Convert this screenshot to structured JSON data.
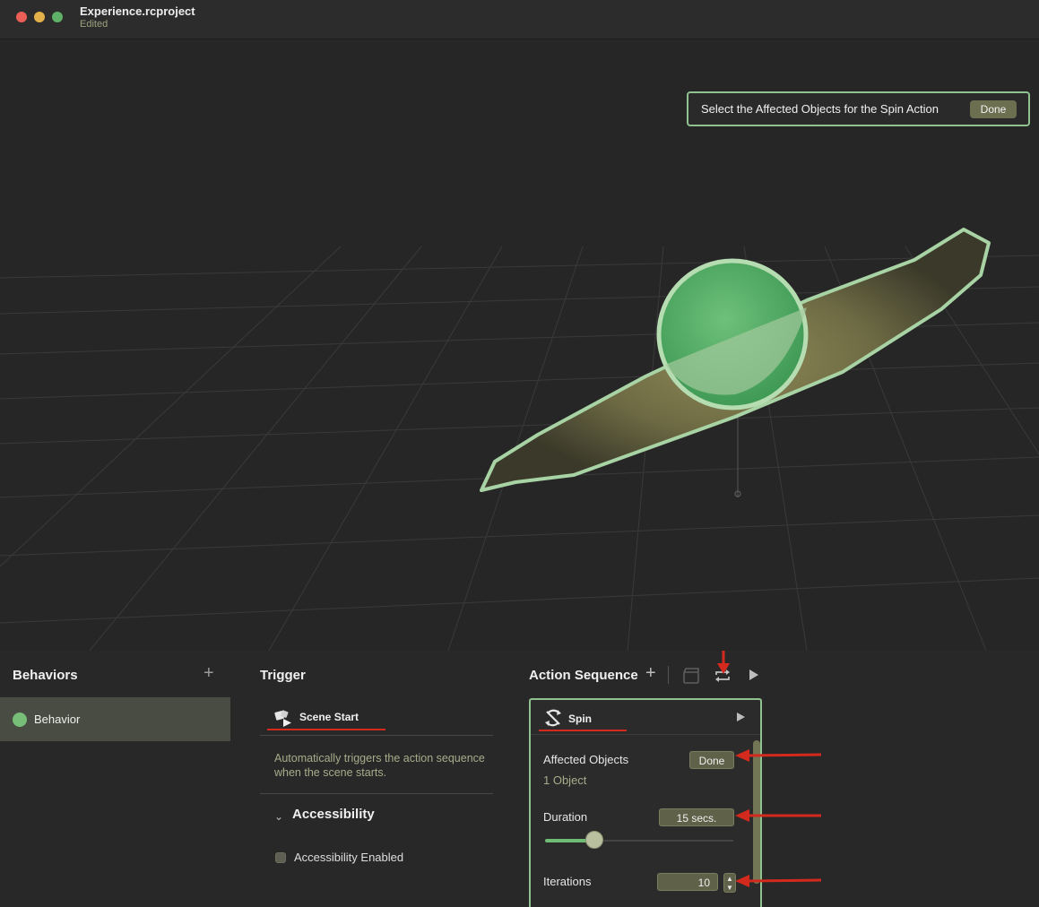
{
  "window": {
    "title": "Experience.rcproject",
    "subtitle": "Edited"
  },
  "banner": {
    "message": "Select the Affected Objects for the Spin Action",
    "done_label": "Done"
  },
  "behaviors": {
    "header": "Behaviors",
    "add_label": "+",
    "items": [
      {
        "label": "Behavior"
      }
    ]
  },
  "trigger": {
    "header": "Trigger",
    "name": "Scene Start",
    "description": "Automatically triggers the action sequence when the scene starts.",
    "accessibility": {
      "title": "Accessibility",
      "checkbox_label": "Accessibility Enabled"
    }
  },
  "action_sequence": {
    "header": "Action Sequence",
    "add_label": "+",
    "action": {
      "name": "Spin",
      "affected_objects": {
        "label": "Affected Objects",
        "button": "Done",
        "value": "1 Object"
      },
      "duration": {
        "label": "Duration",
        "value": "15 secs.",
        "slider_fraction": 0.22
      },
      "iterations": {
        "label": "Iterations",
        "value": "10"
      }
    }
  },
  "colors": {
    "accent_green": "#8fc28f",
    "annotation_red": "#d42a1e",
    "selection_olive": "#494c42"
  },
  "icons": {
    "trigger": "scene-start-icon",
    "action": "spin-icon",
    "loop": "loop-icon",
    "play": "play-icon"
  }
}
